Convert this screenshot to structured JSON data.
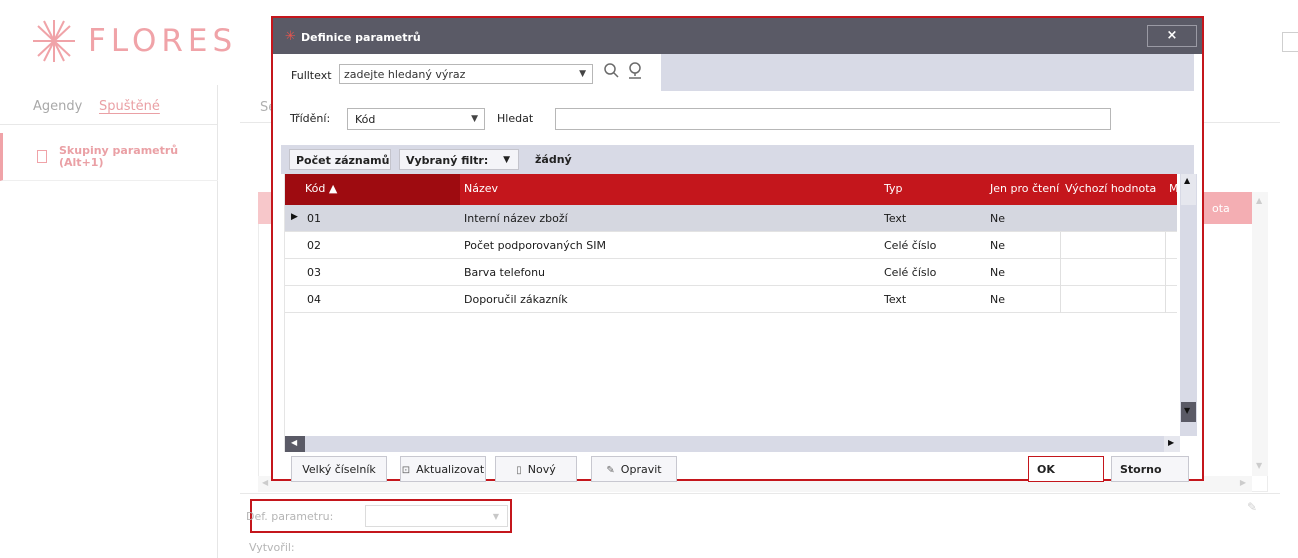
{
  "app": {
    "logo_text": "FLORES",
    "sidebar": {
      "tabs": [
        "Agendy",
        "Spuštěné"
      ],
      "items": [
        {
          "label": "Skupiny parametrů\n(Alt+1)"
        }
      ]
    },
    "bg_tab_fragment": "Se",
    "bg_column_fragment": "ota",
    "def_parametru_label": "Def. parametru:",
    "vytvoril_label": "Vytvořil:"
  },
  "dialog": {
    "title": "Definice parametrů",
    "close_label": "×",
    "fulltext": {
      "label": "Fulltext",
      "placeholder": "zadejte hledaný výraz"
    },
    "sort": {
      "label": "Třídění:",
      "value": "Kód",
      "search_label": "Hledat",
      "search_value": ""
    },
    "filter": {
      "count_button": "Počet záznamů",
      "filter_label": "Vybraný filtr:",
      "filter_value": "žádný"
    },
    "grid": {
      "columns": [
        "Kód",
        "Název",
        "Typ",
        "Jen pro čtení",
        "Výchozí hodnota",
        "M"
      ],
      "sort_indicator": "▲",
      "rows": [
        {
          "kod": "01",
          "nazev": "Interní název zboží",
          "typ": "Text",
          "jen_pro_cteni": "Ne",
          "vychozi": ""
        },
        {
          "kod": "02",
          "nazev": "Počet podporovaných SIM",
          "typ": "Celé číslo",
          "jen_pro_cteni": "Ne",
          "vychozi": ""
        },
        {
          "kod": "03",
          "nazev": "Barva telefonu",
          "typ": "Celé číslo",
          "jen_pro_cteni": "Ne",
          "vychozi": ""
        },
        {
          "kod": "04",
          "nazev": "Doporučil zákazník",
          "typ": "Text",
          "jen_pro_cteni": "Ne",
          "vychozi": ""
        }
      ]
    },
    "footer": {
      "velky_ciselnik": "Velký číselník",
      "aktualizovat": "Aktualizovat",
      "novy": "Nový",
      "opravit": "Opravit",
      "ok": "OK",
      "storno": "Storno"
    }
  },
  "colors": {
    "accent_red": "#c4161c",
    "title_bar": "#5a5a66",
    "toolbar_bg": "#d8dae6"
  },
  "icons": [
    "flores-logo-icon",
    "document-icon",
    "search-icon",
    "search-advanced-icon",
    "close-icon",
    "refresh-icon",
    "new-document-icon",
    "edit-icon",
    "pencil-icon"
  ]
}
